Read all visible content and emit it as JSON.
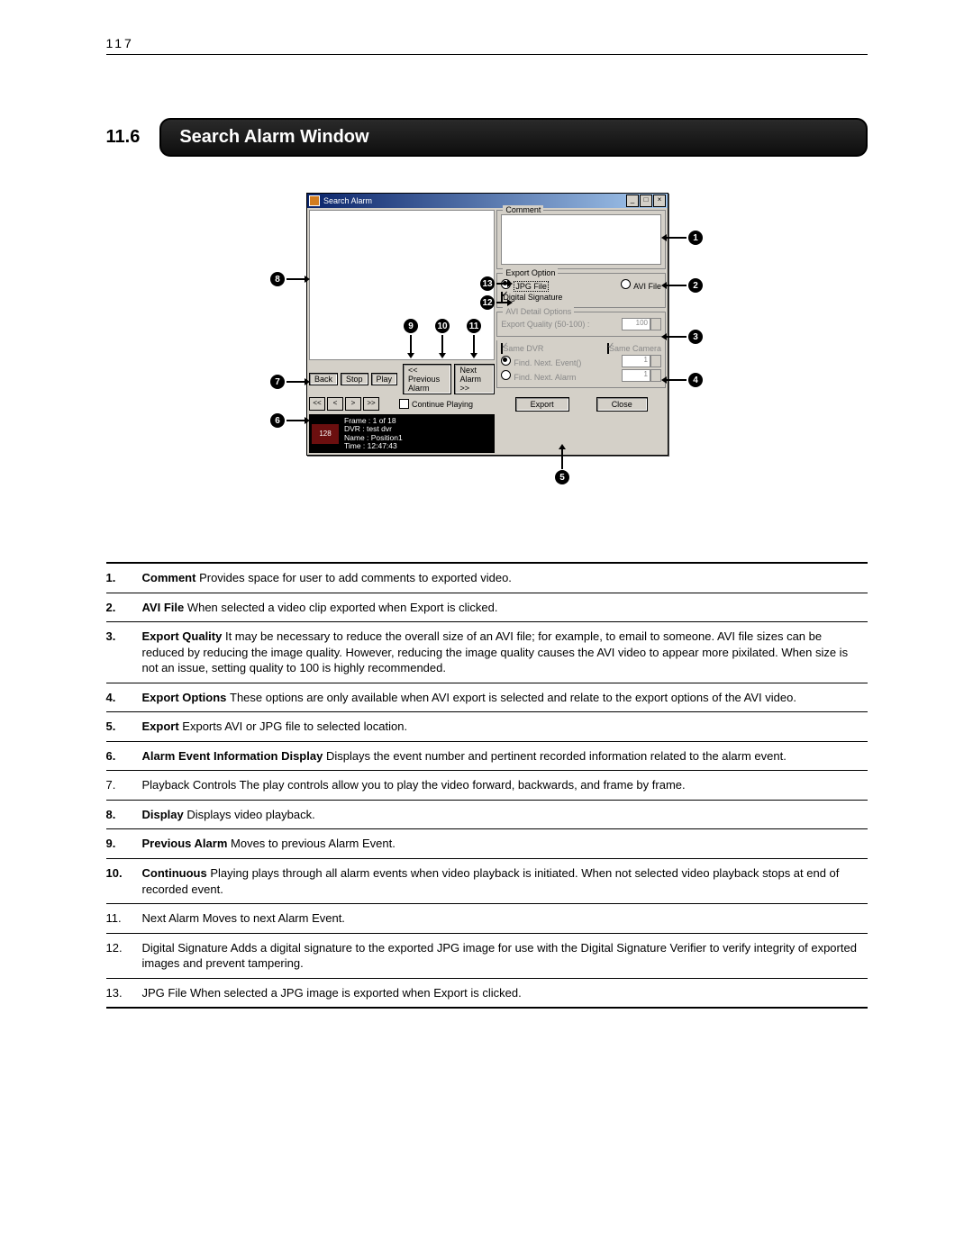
{
  "page_number": "117",
  "section_number": "11.6",
  "section_title": "Search Alarm Window",
  "dialog": {
    "title": "Search Alarm",
    "comment_label": "Comment",
    "export_option_label": "Export Option",
    "jpg_file_label": "JPG File",
    "avi_file_label": "AVI File",
    "digital_signature_label": "Digital Signature",
    "avi_detail_label": "AVI Detail Options",
    "export_quality_label": "Export Quality (50-100) :",
    "export_quality_value": "100",
    "same_dvr_label": "Same DVR",
    "same_camera_label": "Same Camera",
    "find_next_event_label": "Find. Next. Event()",
    "find_next_alarm_label": "Find. Next. Alarm",
    "count_value": "1",
    "export_btn": "Export",
    "close_btn": "Close",
    "back_btn": "Back",
    "stop_btn": "Stop",
    "play_btn": "Play",
    "prev_alarm_btn": "<<  Previous Alarm",
    "next_alarm_btn": "Next Alarm  >>",
    "continue_playing_label": "Continue Playing",
    "info_frame": "Frame  :  1 of 18",
    "info_dvr": "DVR     :  test dvr",
    "info_name": "Name   :  Position1",
    "info_time": "Time    :  12:47:43",
    "thumb_label": "128"
  },
  "callouts": {
    "c1": "1",
    "c2": "2",
    "c3": "3",
    "c4": "4",
    "c5": "5",
    "c6": "6",
    "c7": "7",
    "c8": "8",
    "c9": "9",
    "c10": "10",
    "c11": "11",
    "c12": "12",
    "c13": "13"
  },
  "definitions": [
    {
      "num": "1.",
      "bold": true,
      "term": "Comment",
      "desc": "Provides space for user to add comments to exported video."
    },
    {
      "num": "2.",
      "bold": true,
      "term": "AVI File",
      "desc": "When selected a video clip exported when Export is clicked."
    },
    {
      "num": "3.",
      "bold": true,
      "term": "Export Quality",
      "desc": "It may be necessary to reduce the overall size of an AVI file; for example, to email to someone. AVI file sizes can be reduced by reducing the image quality.  However, reducing the image quality causes the AVI video to appear more pixilated.  When size is not an issue, setting quality to 100 is highly recommended."
    },
    {
      "num": "4.",
      "bold": true,
      "term": "Export Options",
      "desc": "These options are only available when AVI export is selected and relate to the export options of the AVI video."
    },
    {
      "num": "5.",
      "bold": true,
      "term": "Export",
      "desc": "Exports AVI or JPG file to selected location."
    },
    {
      "num": "6.",
      "bold": true,
      "term": "Alarm Event Information Display",
      "desc": "Displays the event number and pertinent recorded information related to the alarm event."
    },
    {
      "num": "7.",
      "bold": false,
      "term": "Playback Controls",
      "desc": "The play controls allow you to play the video forward, backwards, and frame by frame."
    },
    {
      "num": "8.",
      "bold": true,
      "term": "Display",
      "desc": "Displays video playback."
    },
    {
      "num": "9.",
      "bold": true,
      "term": "Previous Alarm",
      "desc": "Moves to previous Alarm Event."
    },
    {
      "num": "10.",
      "bold": true,
      "term": "Continuous",
      "desc": "Playing plays through all alarm events when video playback is initiated. When not selected video playback stops at end of recorded event."
    },
    {
      "num": "11.",
      "bold": false,
      "term": "Next Alarm",
      "desc": "Moves to next Alarm Event."
    },
    {
      "num": "12.",
      "bold": false,
      "term": "Digital Signature",
      "desc": "Adds a digital signature to the exported JPG image for use with the Digital Signature Verifier to verify integrity of exported images and prevent tampering."
    },
    {
      "num": "13.",
      "bold": false,
      "term": "JPG File",
      "desc": "When selected a JPG image is exported when Export is clicked."
    }
  ]
}
